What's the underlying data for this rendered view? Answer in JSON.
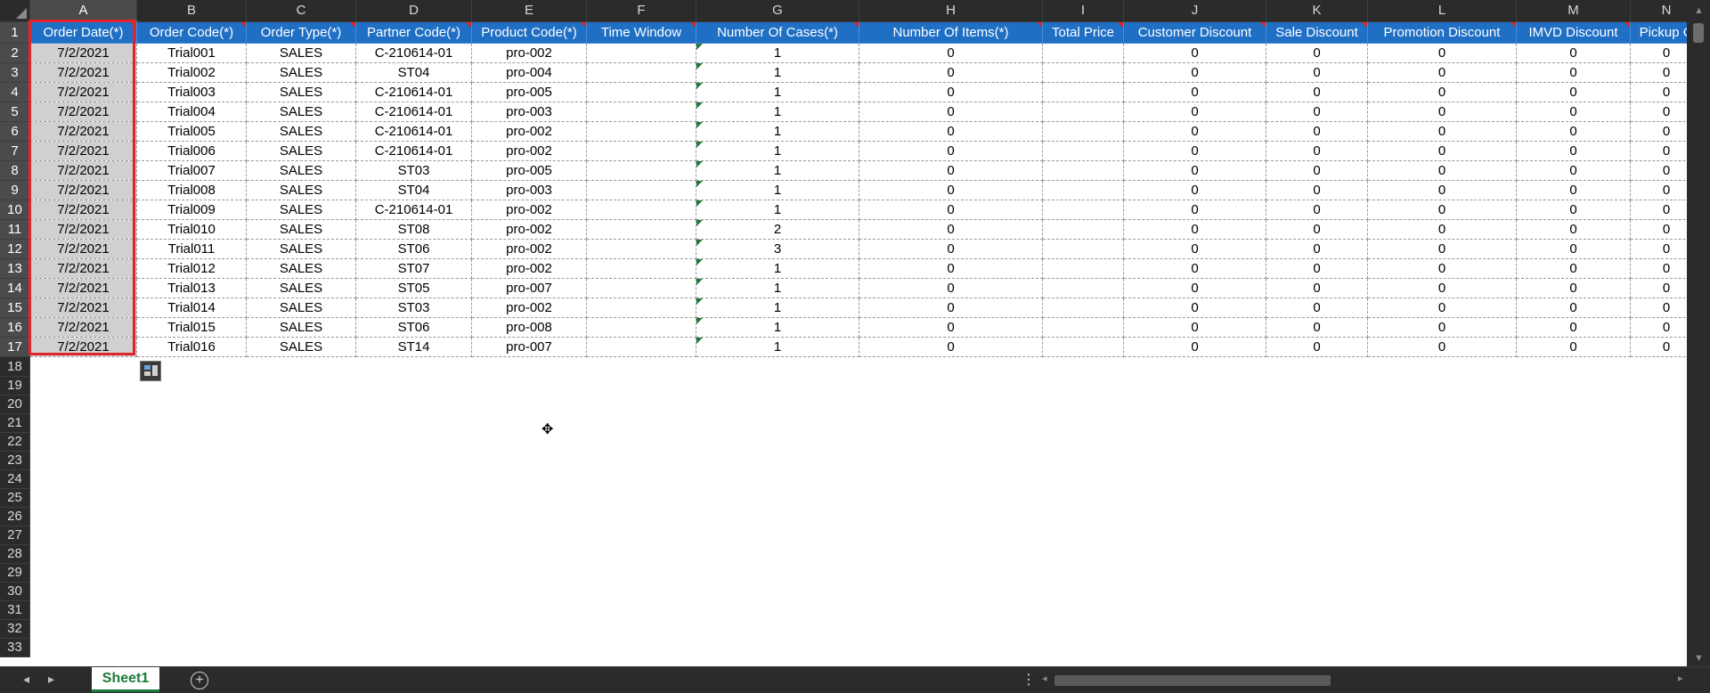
{
  "columns": [
    "A",
    "B",
    "C",
    "D",
    "E",
    "F",
    "G",
    "H",
    "I",
    "J",
    "K",
    "L",
    "M",
    "N"
  ],
  "headers": [
    "Order Date(*)",
    "Order Code(*)",
    "Order Type(*)",
    "Partner Code(*)",
    "Product Code(*)",
    "Time Window",
    "Number Of Cases(*)",
    "Number Of Items(*)",
    "Total Price",
    "Customer Discount",
    "Sale Discount",
    "Promotion Discount",
    "IMVD Discount",
    "Pickup O"
  ],
  "rows": [
    [
      "7/2/2021",
      "Trial001",
      "SALES",
      "C-210614-01",
      "pro-002",
      "",
      "1",
      "0",
      "",
      "0",
      "0",
      "0",
      "0",
      "0"
    ],
    [
      "7/2/2021",
      "Trial002",
      "SALES",
      "ST04",
      "pro-004",
      "",
      "1",
      "0",
      "",
      "0",
      "0",
      "0",
      "0",
      "0"
    ],
    [
      "7/2/2021",
      "Trial003",
      "SALES",
      "C-210614-01",
      "pro-005",
      "",
      "1",
      "0",
      "",
      "0",
      "0",
      "0",
      "0",
      "0"
    ],
    [
      "7/2/2021",
      "Trial004",
      "SALES",
      "C-210614-01",
      "pro-003",
      "",
      "1",
      "0",
      "",
      "0",
      "0",
      "0",
      "0",
      "0"
    ],
    [
      "7/2/2021",
      "Trial005",
      "SALES",
      "C-210614-01",
      "pro-002",
      "",
      "1",
      "0",
      "",
      "0",
      "0",
      "0",
      "0",
      "0"
    ],
    [
      "7/2/2021",
      "Trial006",
      "SALES",
      "C-210614-01",
      "pro-002",
      "",
      "1",
      "0",
      "",
      "0",
      "0",
      "0",
      "0",
      "0"
    ],
    [
      "7/2/2021",
      "Trial007",
      "SALES",
      "ST03",
      "pro-005",
      "",
      "1",
      "0",
      "",
      "0",
      "0",
      "0",
      "0",
      "0"
    ],
    [
      "7/2/2021",
      "Trial008",
      "SALES",
      "ST04",
      "pro-003",
      "",
      "1",
      "0",
      "",
      "0",
      "0",
      "0",
      "0",
      "0"
    ],
    [
      "7/2/2021",
      "Trial009",
      "SALES",
      "C-210614-01",
      "pro-002",
      "",
      "1",
      "0",
      "",
      "0",
      "0",
      "0",
      "0",
      "0"
    ],
    [
      "7/2/2021",
      "Trial010",
      "SALES",
      "ST08",
      "pro-002",
      "",
      "2",
      "0",
      "",
      "0",
      "0",
      "0",
      "0",
      "0"
    ],
    [
      "7/2/2021",
      "Trial011",
      "SALES",
      "ST06",
      "pro-002",
      "",
      "3",
      "0",
      "",
      "0",
      "0",
      "0",
      "0",
      "0"
    ],
    [
      "7/2/2021",
      "Trial012",
      "SALES",
      "ST07",
      "pro-002",
      "",
      "1",
      "0",
      "",
      "0",
      "0",
      "0",
      "0",
      "0"
    ],
    [
      "7/2/2021",
      "Trial013",
      "SALES",
      "ST05",
      "pro-007",
      "",
      "1",
      "0",
      "",
      "0",
      "0",
      "0",
      "0",
      "0"
    ],
    [
      "7/2/2021",
      "Trial014",
      "SALES",
      "ST03",
      "pro-002",
      "",
      "1",
      "0",
      "",
      "0",
      "0",
      "0",
      "0",
      "0"
    ],
    [
      "7/2/2021",
      "Trial015",
      "SALES",
      "ST06",
      "pro-008",
      "",
      "1",
      "0",
      "",
      "0",
      "0",
      "0",
      "0",
      "0"
    ],
    [
      "7/2/2021",
      "Trial016",
      "SALES",
      "ST14",
      "pro-007",
      "",
      "1",
      "0",
      "",
      "0",
      "0",
      "0",
      "0",
      "0"
    ]
  ],
  "row_numbers": [
    "1",
    "2",
    "3",
    "4",
    "5",
    "6",
    "7",
    "8",
    "9",
    "10",
    "11",
    "12",
    "13",
    "14",
    "15",
    "16",
    "17",
    "18",
    "19",
    "20",
    "21",
    "22",
    "23",
    "24",
    "25",
    "26",
    "27",
    "28",
    "29",
    "30",
    "31",
    "32",
    "33"
  ],
  "selected_column": "A",
  "sheet_tab": "Sheet1",
  "add_sheet_icon": "plus-circle-icon",
  "colors": {
    "header_fill": "#1f6fc5",
    "selection_outline": "#e0242c",
    "selected_cells": "#d0d0d0",
    "tab_accent": "#1e7a3a"
  }
}
